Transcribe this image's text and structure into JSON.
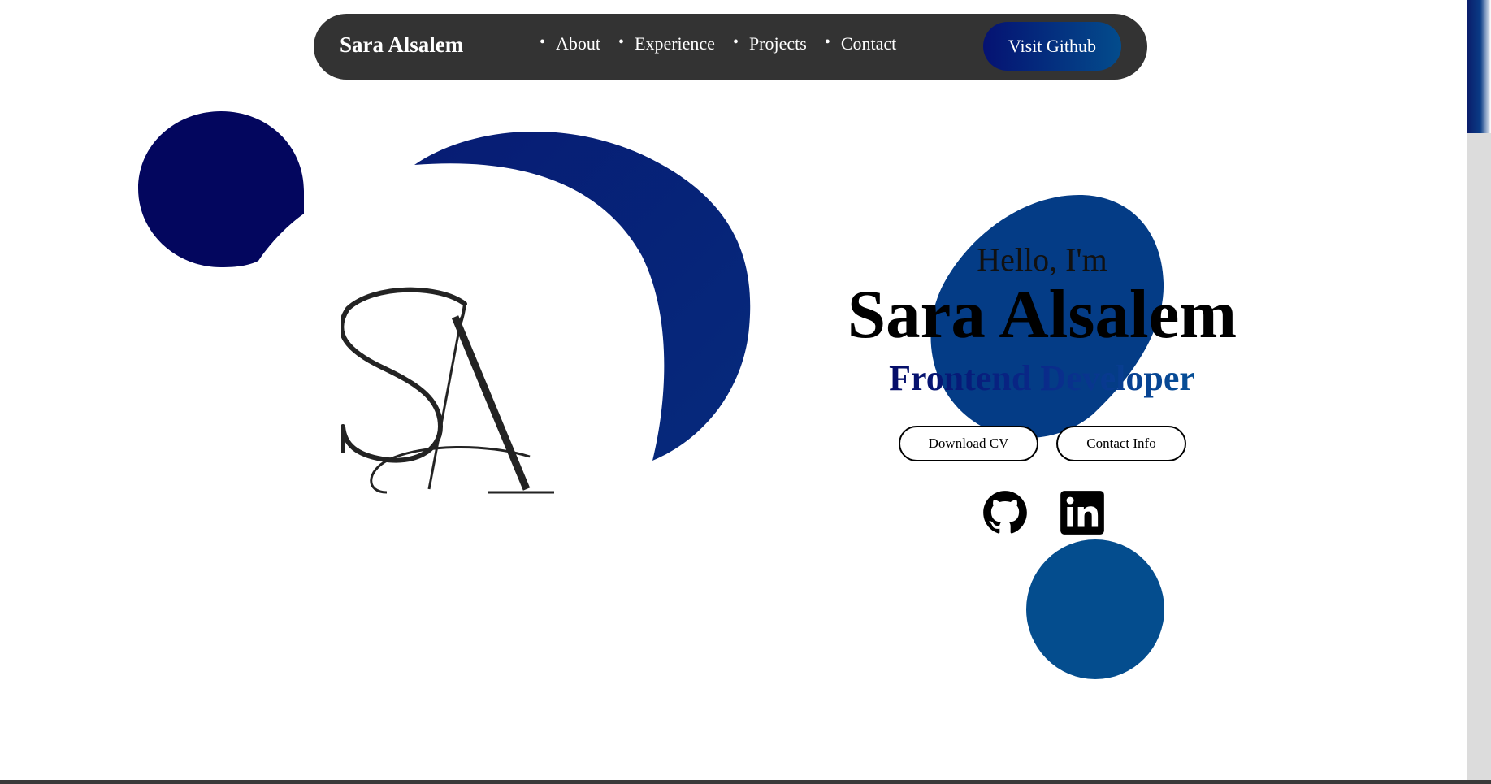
{
  "navbar": {
    "brand": "Sara Alsalem",
    "links": [
      "About",
      "Experience",
      "Projects",
      "Contact"
    ],
    "cta_label": "Visit Github"
  },
  "hero": {
    "greeting": "Hello, I'm",
    "name": "Sara Alsalem",
    "role": "Frontend Developer",
    "buttons": {
      "download_cv": "Download CV",
      "contact_info": "Contact Info"
    },
    "logo_monogram": "SA"
  },
  "socials": [
    "github-icon",
    "linkedin-icon"
  ],
  "colors": {
    "navbar_bg": "#333333",
    "accent_dark": "#03045e",
    "accent_mid": "#0a2a8a",
    "accent_light": "#055a9a",
    "blob_blue": "#044d8e"
  }
}
